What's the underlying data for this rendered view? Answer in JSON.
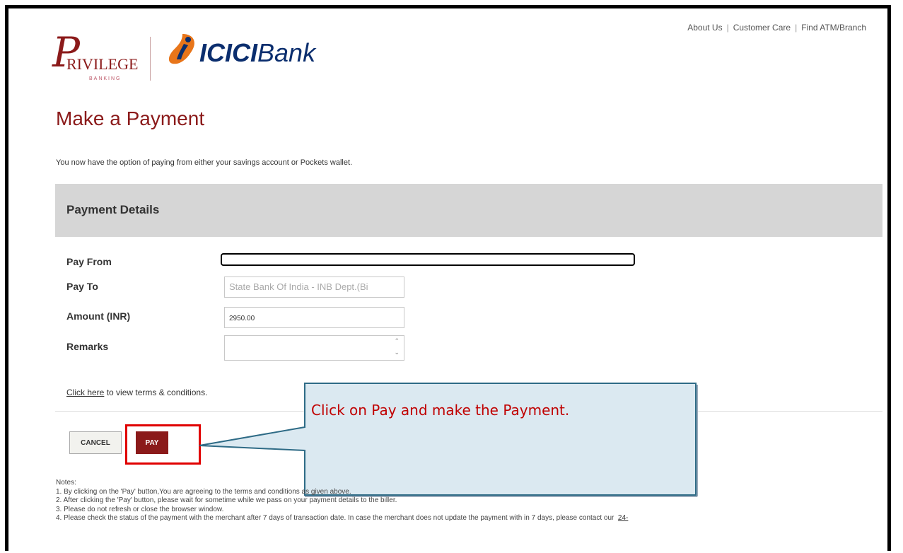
{
  "topnav": {
    "items": [
      "About Us",
      "Customer Care",
      "Find ATM/Branch"
    ]
  },
  "logos": {
    "privilege_initial": "P",
    "privilege_text": "RIVILEGE",
    "privilege_sub": "BANKING",
    "icici_name": "ICICI",
    "icici_bank": "Bank"
  },
  "page": {
    "title": "Make a Payment",
    "intro": "You now have the option of paying from either your savings account or Pockets wallet."
  },
  "section": {
    "title": "Payment Details"
  },
  "form": {
    "pay_from_label": "Pay From",
    "pay_to_label": "Pay To",
    "pay_to_value": "State Bank Of India - INB Dept.(Bi",
    "amount_label": "Amount (INR)",
    "amount_value": "2950.00",
    "remarks_label": "Remarks"
  },
  "terms": {
    "link": "Click here",
    "text": " to view terms & conditions."
  },
  "buttons": {
    "cancel": "CANCEL",
    "pay": "PAY"
  },
  "callout": {
    "text": "Click on Pay and make the Payment."
  },
  "notes": {
    "heading": "Notes:",
    "items": [
      "1. By clicking on the 'Pay' button,You are agreeing to the terms and conditions as given above.",
      "2. After clicking the 'Pay' button, please wait for sometime while we pass on your payment details to the biller.",
      "3. Please do not refresh or close the browser window.",
      "4. Please check the status of the payment with the merchant after 7 days of transaction date. In case the merchant does not update the payment with in 7 days, please contact our"
    ],
    "item4_link": "24-"
  },
  "colors": {
    "brand": "#8b1a1a",
    "icici_blue": "#0b2e6e",
    "icici_orange": "#e8751a",
    "callout_fill": "#dbe9f1",
    "callout_border": "#2e6b86",
    "highlight": "#e00000"
  }
}
